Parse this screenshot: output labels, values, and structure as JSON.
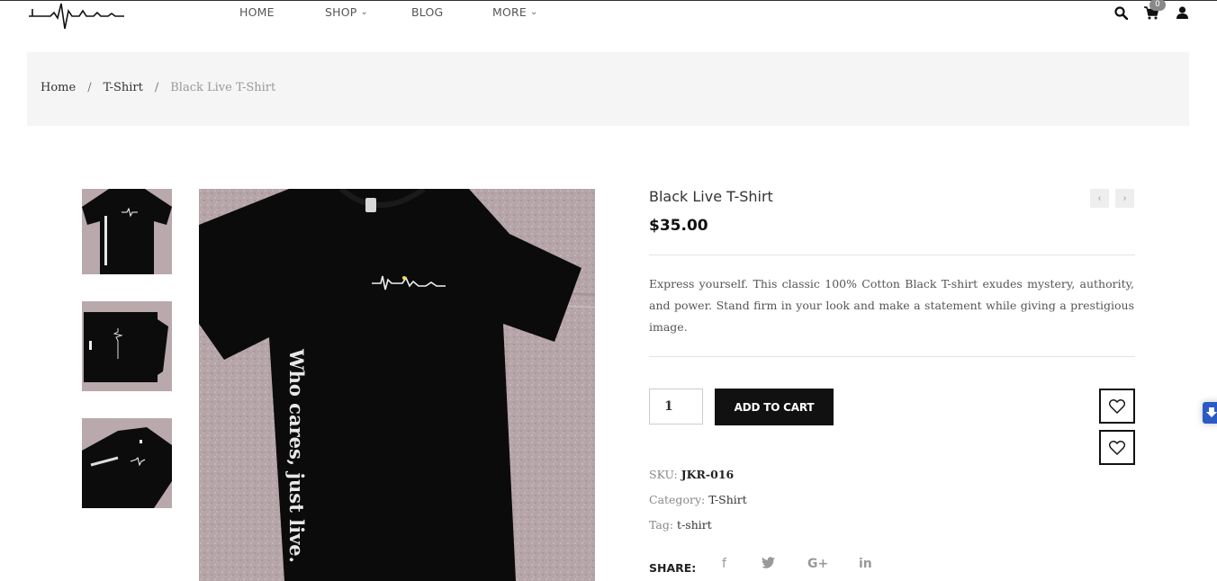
{
  "header": {
    "nav": [
      {
        "label": "HOME"
      },
      {
        "label": "SHOP"
      },
      {
        "label": "BLOG"
      },
      {
        "label": "MORE"
      }
    ],
    "cart_count": "0"
  },
  "breadcrumb": {
    "items": [
      "Home",
      "T-Shirt",
      "Black Live T-Shirt"
    ],
    "separator": "/"
  },
  "product": {
    "title": "Black Live T-Shirt",
    "price": "$35.00",
    "description": "Express yourself. This classic 100% Cotton Black T-shirt exudes mystery, authority, and power. Stand firm in your look and make a statement while giving a prestigious image.",
    "quantity": "1",
    "add_to_cart_label": "ADD TO CART",
    "shirt_text": "Who cares, just live.",
    "meta": {
      "sku_label": "SKU:",
      "sku": "JKR-016",
      "category_label": "Category:",
      "category": "T-Shirt",
      "tag_label": "Tag:",
      "tag": "t-shirt"
    },
    "share_label": "SHARE:",
    "share_icons": [
      "facebook-icon",
      "twitter-icon",
      "google-plus-icon",
      "linkedin-icon"
    ]
  },
  "colors": {
    "accent": "#111111",
    "crumb_bg": "#f5f5f5",
    "side_tab": "#2a5ac4"
  }
}
